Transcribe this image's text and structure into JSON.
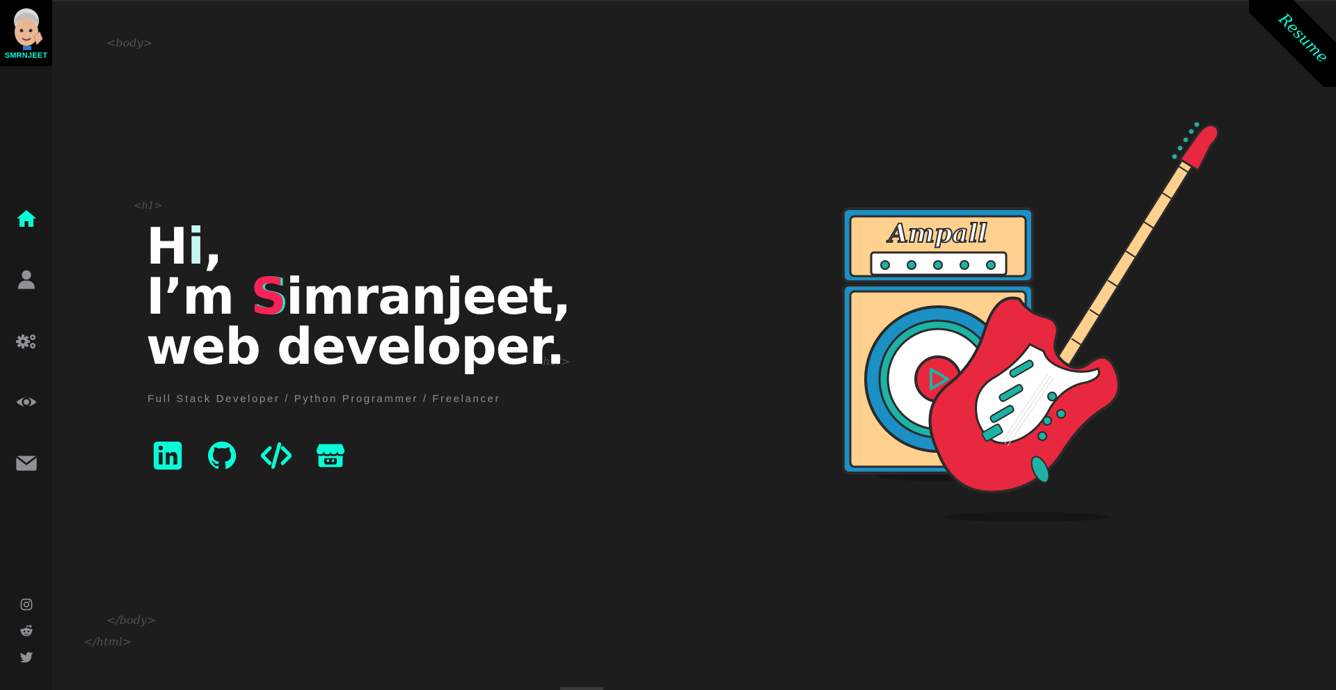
{
  "logo": {
    "text": "SMRNJEET"
  },
  "nav": [
    {
      "name": "home",
      "icon": "home-icon",
      "active": true
    },
    {
      "name": "about",
      "icon": "user-icon"
    },
    {
      "name": "skills",
      "icon": "gears-icon"
    },
    {
      "name": "work",
      "icon": "eye-icon"
    },
    {
      "name": "contact",
      "icon": "envelope-icon"
    }
  ],
  "side_socials": [
    "instagram-icon",
    "reddit-icon",
    "twitter-icon"
  ],
  "tags": {
    "body_open": "<body>",
    "h1_open": "<h1>",
    "h1_close": "<h1/>",
    "body_close": "</body>",
    "html_close": "</html>"
  },
  "hero": {
    "line1_a": "H",
    "line1_b": "i",
    "line1_c": ",",
    "line2_a": "I’m ",
    "line2_b": "S",
    "line2_c": "imranjeet,",
    "line3": "web developer."
  },
  "subtitle": "Full Stack Developer / Python Programmer / Freelancer",
  "hero_socials": [
    "linkedin-icon",
    "github-icon",
    "code-icon",
    "store-icon"
  ],
  "resume": {
    "label": "Resume"
  },
  "illustration": {
    "brand": "Ampall"
  },
  "colors": {
    "accent": "#08fdd8",
    "pink": "#fd2155",
    "bg": "#1d1d1d",
    "sidebar": "#181818"
  }
}
